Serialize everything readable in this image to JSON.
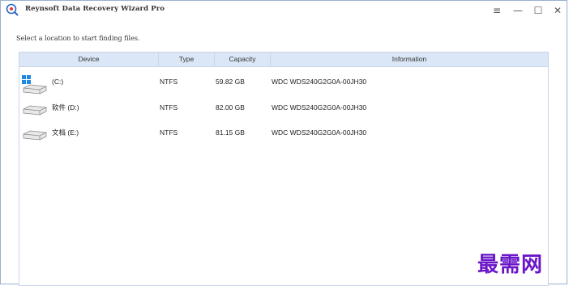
{
  "window": {
    "title": "Reynsoft Data Recovery Wizard Pro",
    "controls": {
      "menu": "≡",
      "minimize": "—",
      "maximize": "☐",
      "close": "✕"
    }
  },
  "main": {
    "prompt": "Select a location to start finding files.",
    "table": {
      "columns": {
        "device": "Device",
        "type": "Type",
        "capacity": "Capacity",
        "information": "Information"
      },
      "rows": [
        {
          "name": "(C:)",
          "type": "NTFS",
          "capacity": "59.82 GB",
          "information": "WDC WDS240G2G0A-00JH30",
          "icon": "windows-drive-icon"
        },
        {
          "name": "软件 (D:)",
          "type": "NTFS",
          "capacity": "82.00 GB",
          "information": "WDC WDS240G2G0A-00JH30",
          "icon": "drive-icon"
        },
        {
          "name": "文档 (E:)",
          "type": "NTFS",
          "capacity": "81.15 GB",
          "information": "WDC WDS240G2G0A-00JH30",
          "icon": "drive-icon"
        }
      ]
    }
  },
  "watermark": "最需网",
  "colors": {
    "header_bg": "#dbe7f6",
    "border": "#c7d6ea",
    "watermark": "#6a16c8",
    "windows_logo": "#1e88e5"
  }
}
